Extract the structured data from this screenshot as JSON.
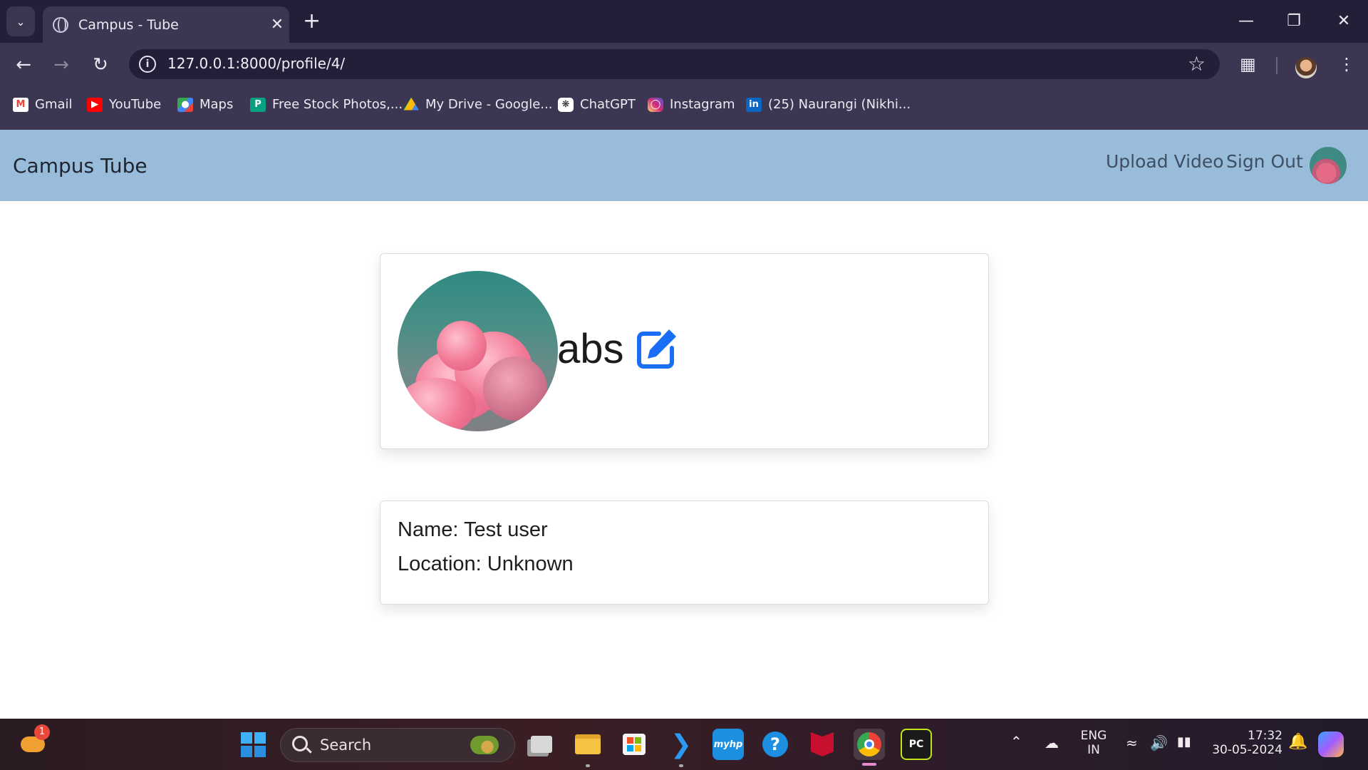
{
  "browser": {
    "tab_title": "Campus - Tube",
    "url": "127.0.0.1:8000/profile/4/",
    "bookmarks": [
      {
        "label": "Gmail",
        "icon": "gmail-icon",
        "color": "#ea4335"
      },
      {
        "label": "YouTube",
        "icon": "youtube-icon",
        "color": "#ff0000"
      },
      {
        "label": "Maps",
        "icon": "maps-icon",
        "color": "#34a853"
      },
      {
        "label": "Free Stock Photos,...",
        "icon": "pexels-icon",
        "color": "#07a081"
      },
      {
        "label": "My Drive - Google...",
        "icon": "drive-icon",
        "color": "#fbbc04"
      },
      {
        "label": "ChatGPT",
        "icon": "chatgpt-icon",
        "color": "#ffffff"
      },
      {
        "label": "Instagram",
        "icon": "instagram-icon",
        "color": "#d6249f"
      },
      {
        "label": "(25) Naurangi (Nikhi...",
        "icon": "linkedin-icon",
        "color": "#0a66c2"
      }
    ]
  },
  "navbar": {
    "brand": "Campus Tube",
    "upload": "Upload Video",
    "signout": "Sign Out",
    "bg_color": "#98bcda"
  },
  "profile": {
    "username": "abs",
    "name_line": "Name: Test user",
    "location_line": "Location: Unknown",
    "edit_icon_color": "#1a6ef5"
  },
  "taskbar": {
    "search_label": "Search",
    "notification_badge": "1",
    "lang_top": "ENG",
    "lang_bottom": "IN",
    "time": "17:32",
    "date": "30-05-2024"
  }
}
